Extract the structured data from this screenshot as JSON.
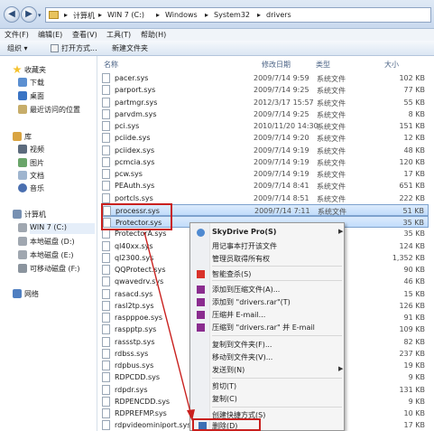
{
  "address": {
    "crumbs": [
      "计算机",
      "WIN 7 (C:)",
      "Windows",
      "System32",
      "drivers"
    ]
  },
  "menubar": {
    "items": [
      "文件(F)",
      "编辑(E)",
      "查看(V)",
      "工具(T)",
      "帮助(H)"
    ]
  },
  "toolbar": {
    "organize": "组织 ▾",
    "open_with": "打开方式...",
    "new_folder": "新建文件夹"
  },
  "navpane": {
    "favorites": "收藏夹",
    "downloads": "下载",
    "desktop": "桌面",
    "recent": "最近访问的位置",
    "libraries": "库",
    "videos": "视频",
    "pictures": "图片",
    "documents": "文档",
    "music": "音乐",
    "computer": "计算机",
    "drive_c": "WIN 7 (C:)",
    "drive_d": "本地磁盘 (D:)",
    "drive_e": "本地磁盘 (E:)",
    "drive_f": "可移动磁盘 (F:)",
    "network": "网络"
  },
  "columns": {
    "name": "名称",
    "date": "修改日期",
    "type": "类型",
    "size": "大小"
  },
  "files": [
    {
      "name": "pacer.sys",
      "date": "2009/7/14 9:59",
      "type": "系统文件",
      "size": "102 KB"
    },
    {
      "name": "parport.sys",
      "date": "2009/7/14 9:25",
      "type": "系统文件",
      "size": "77 KB"
    },
    {
      "name": "partmgr.sys",
      "date": "2012/3/17 15:57",
      "type": "系统文件",
      "size": "55 KB"
    },
    {
      "name": "parvdm.sys",
      "date": "2009/7/14 9:25",
      "type": "系统文件",
      "size": "8 KB"
    },
    {
      "name": "pci.sys",
      "date": "2010/11/20 14:30",
      "type": "系统文件",
      "size": "151 KB"
    },
    {
      "name": "pciide.sys",
      "date": "2009/7/14 9:20",
      "type": "系统文件",
      "size": "12 KB"
    },
    {
      "name": "pciidex.sys",
      "date": "2009/7/14 9:19",
      "type": "系统文件",
      "size": "48 KB"
    },
    {
      "name": "pcmcia.sys",
      "date": "2009/7/14 9:19",
      "type": "系统文件",
      "size": "120 KB"
    },
    {
      "name": "pcw.sys",
      "date": "2009/7/14 9:19",
      "type": "系统文件",
      "size": "17 KB"
    },
    {
      "name": "PEAuth.sys",
      "date": "2009/7/14 8:41",
      "type": "系统文件",
      "size": "651 KB"
    },
    {
      "name": "portcls.sys",
      "date": "2009/7/14 8:51",
      "type": "系统文件",
      "size": "222 KB"
    },
    {
      "name": "processr.sys",
      "date": "2009/7/14 7:11",
      "type": "系统文件",
      "size": "51 KB"
    },
    {
      "name": "Protector.sys",
      "date": "",
      "type": "",
      "size": "35 KB"
    },
    {
      "name": "ProtectorA.sys",
      "date": "",
      "type": "",
      "size": "35 KB"
    },
    {
      "name": "ql40xx.sys",
      "date": "",
      "type": "",
      "size": "124 KB"
    },
    {
      "name": "ql2300.sys",
      "date": "",
      "type": "",
      "size": "1,352 KB"
    },
    {
      "name": "QQProtect.sys",
      "date": "",
      "type": "",
      "size": "90 KB"
    },
    {
      "name": "qwavedrv.sys",
      "date": "",
      "type": "",
      "size": "46 KB"
    },
    {
      "name": "rasacd.sys",
      "date": "",
      "type": "",
      "size": "15 KB"
    },
    {
      "name": "rasl2tp.sys",
      "date": "",
      "type": "",
      "size": "126 KB"
    },
    {
      "name": "raspppoe.sys",
      "date": "",
      "type": "",
      "size": "91 KB"
    },
    {
      "name": "raspptp.sys",
      "date": "",
      "type": "",
      "size": "109 KB"
    },
    {
      "name": "rassstp.sys",
      "date": "",
      "type": "",
      "size": "82 KB"
    },
    {
      "name": "rdbss.sys",
      "date": "",
      "type": "",
      "size": "237 KB"
    },
    {
      "name": "rdpbus.sys",
      "date": "",
      "type": "",
      "size": "19 KB"
    },
    {
      "name": "RDPCDD.sys",
      "date": "",
      "type": "",
      "size": "9 KB"
    },
    {
      "name": "rdpdr.sys",
      "date": "",
      "type": "",
      "size": "131 KB"
    },
    {
      "name": "RDPENCDD.sys",
      "date": "",
      "type": "",
      "size": "9 KB"
    },
    {
      "name": "RDPREFMP.sys",
      "date": "",
      "type": "",
      "size": "10 KB"
    },
    {
      "name": "rdpvideominiport.sys",
      "date": "",
      "type": "",
      "size": "17 KB"
    }
  ],
  "context_menu": {
    "skydrive": "SkyDrive Pro(S)",
    "notepad": "用记事本打开该文件",
    "admin": "管理员取得所有权",
    "smart_delete": "智能查杀(S)",
    "add_archive": "添加到压缩文件(A)...",
    "add_rar": "添加到 \"drivers.rar\"(T)",
    "compress_email": "压缩并 E-mail...",
    "compress_rar_email": "压缩到 \"drivers.rar\" 并 E-mail",
    "copy_to": "复制到文件夹(F)...",
    "move_to": "移动到文件夹(V)...",
    "send_to": "发送到(N)",
    "cut": "剪切(T)",
    "copy": "复制(C)",
    "create_shortcut": "创建快捷方式(S)",
    "delete": "删除(D)"
  },
  "colors": {
    "highlight_red": "#c9201e",
    "selection_blue": "#c1dcfb"
  }
}
